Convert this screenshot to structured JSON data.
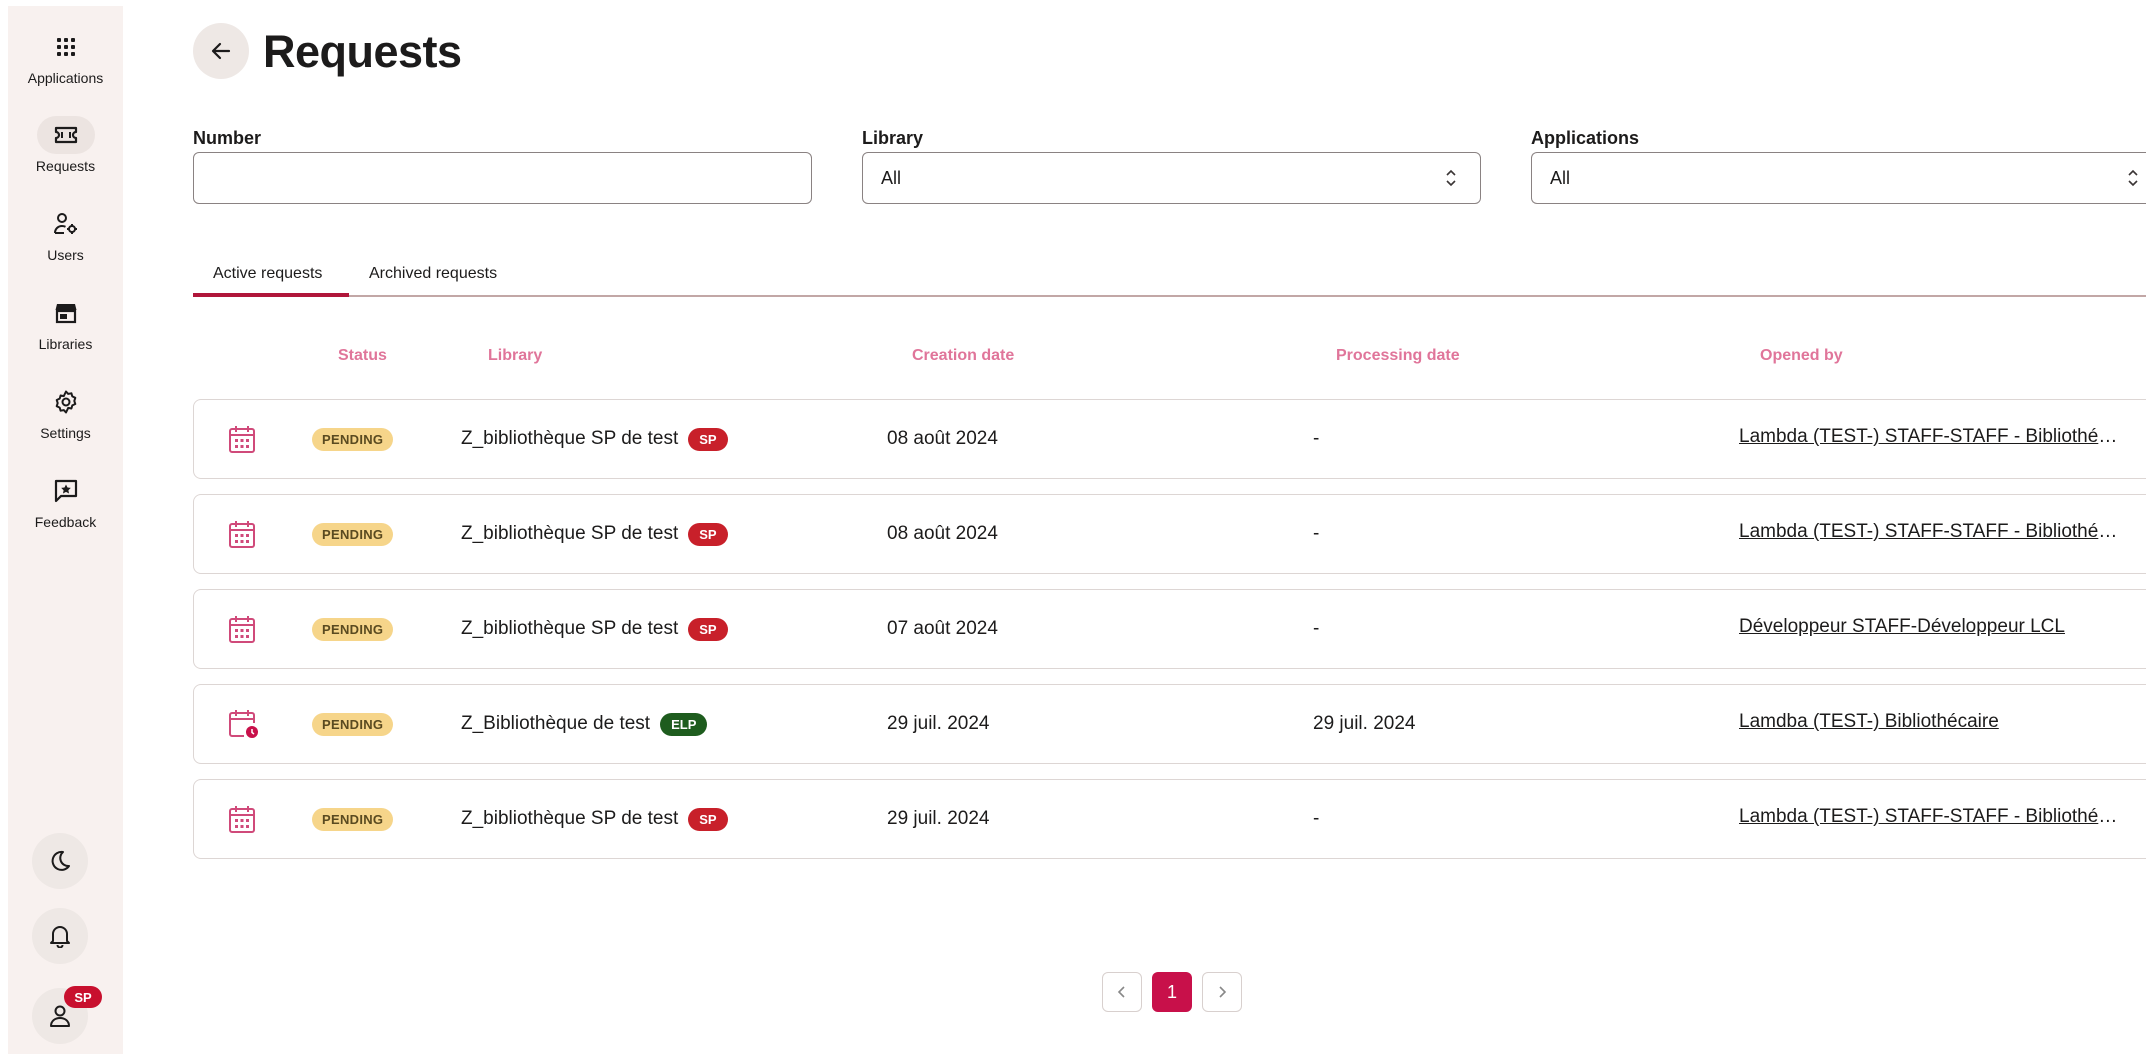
{
  "sidebar": {
    "items": [
      {
        "label": "Applications",
        "icon": "apps-grid-icon"
      },
      {
        "label": "Requests",
        "icon": "ticket-icon"
      },
      {
        "label": "Users",
        "icon": "users-gear-icon"
      },
      {
        "label": "Libraries",
        "icon": "store-icon"
      },
      {
        "label": "Settings",
        "icon": "gear-icon"
      },
      {
        "label": "Feedback",
        "icon": "feedback-star-icon"
      }
    ],
    "user_badge": "SP"
  },
  "header": {
    "title": "Requests"
  },
  "filters": {
    "number_label": "Number",
    "number_value": "",
    "library_label": "Library",
    "library_value": "All",
    "applications_label": "Applications",
    "applications_value": "All"
  },
  "tabs": [
    {
      "label": "Active requests",
      "active": true
    },
    {
      "label": "Archived requests",
      "active": false
    }
  ],
  "table": {
    "columns": {
      "status": "Status",
      "library": "Library",
      "creation_date": "Creation date",
      "processing_date": "Processing date",
      "opened_by": "Opened by"
    },
    "rows": [
      {
        "icon": "calendar-icon",
        "status": "PENDING",
        "library": "Z_bibliothèque SP de test",
        "badge": "SP",
        "created": "08 août 2024",
        "processed": "-",
        "opened_by": "Lambda (TEST-) STAFF-STAFF - Bibliothécaire"
      },
      {
        "icon": "calendar-icon",
        "status": "PENDING",
        "library": "Z_bibliothèque SP de test",
        "badge": "SP",
        "created": "08 août 2024",
        "processed": "-",
        "opened_by": "Lambda (TEST-) STAFF-STAFF - Bibliothécaire"
      },
      {
        "icon": "calendar-icon",
        "status": "PENDING",
        "library": "Z_bibliothèque SP de test",
        "badge": "SP",
        "created": "07 août 2024",
        "processed": "-",
        "opened_by": "Développeur STAFF-Développeur LCL"
      },
      {
        "icon": "calendar-clock-icon",
        "status": "PENDING",
        "library": "Z_Bibliothèque de test",
        "badge": "ELP",
        "created": "29 juil. 2024",
        "processed": "29 juil. 2024",
        "opened_by": "Lamdba (TEST-) Bibliothécaire"
      },
      {
        "icon": "calendar-icon",
        "status": "PENDING",
        "library": "Z_bibliothèque SP de test",
        "badge": "SP",
        "created": "29 juil. 2024",
        "processed": "-",
        "opened_by": "Lambda (TEST-) STAFF-STAFF - Bibliothécaire"
      }
    ]
  },
  "pagination": {
    "current_page": "1"
  },
  "colors": {
    "accent": "#c8104a",
    "badge_sp": "#c8202a",
    "badge_elp": "#1e5c1e",
    "pending": "#f6d58a",
    "column_header": "#e0759a"
  }
}
